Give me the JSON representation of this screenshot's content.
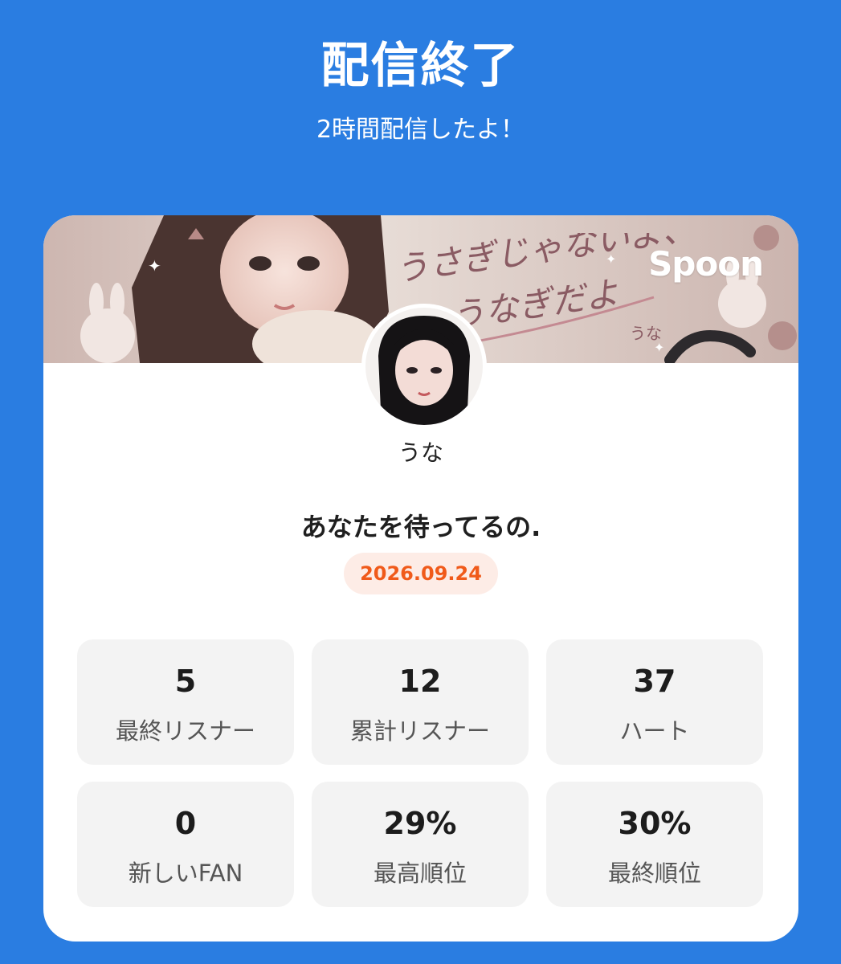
{
  "header": {
    "title": "配信終了",
    "subtitle": "2時間配信したよ！"
  },
  "banner": {
    "brand": "Spoon",
    "artwork_text": "うさぎじゃないよ、うなぎだよ",
    "artwork_signature": "うな"
  },
  "profile": {
    "username": "うな"
  },
  "stream": {
    "title": "あなたを待ってるの.",
    "date": "2026.09.24"
  },
  "stats": [
    {
      "value": "5",
      "label": "最終リスナー"
    },
    {
      "value": "12",
      "label": "累計リスナー"
    },
    {
      "value": "37",
      "label": "ハート"
    },
    {
      "value": "0",
      "label": "新しいFAN"
    },
    {
      "value": "29%",
      "label": "最高順位"
    },
    {
      "value": "30%",
      "label": "最終順位"
    }
  ],
  "colors": {
    "background": "#2a7de1",
    "card": "#ffffff",
    "stat_tile": "#f3f3f3",
    "date_badge_bg": "#fdece6",
    "date_badge_text": "#f05a1a"
  }
}
